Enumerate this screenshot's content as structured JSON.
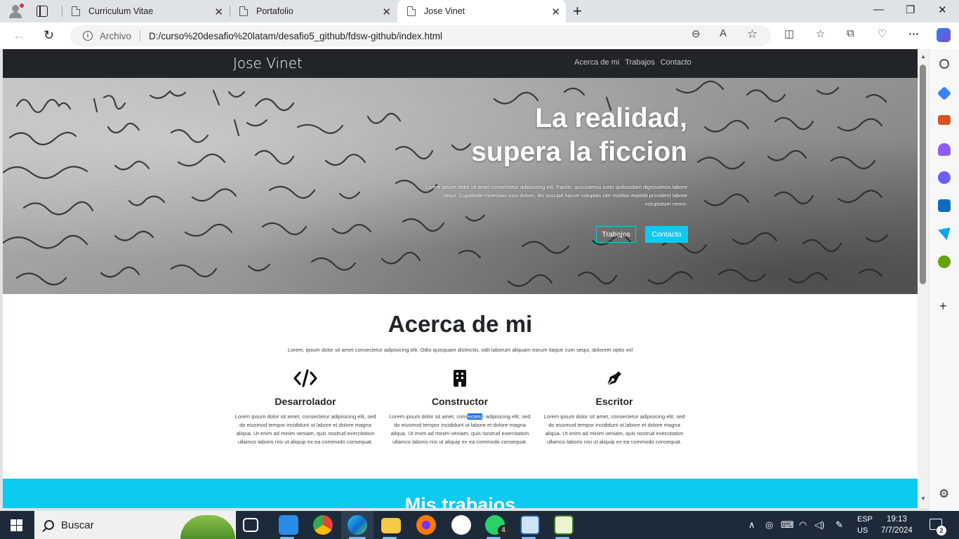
{
  "browser": {
    "tabs": [
      {
        "title": "Curriculum Vitae",
        "active": false
      },
      {
        "title": "Portafolio",
        "active": false
      },
      {
        "title": "Jose Vinet",
        "active": true
      }
    ],
    "address": {
      "protocol_label": "Archivo",
      "url": "D:/curso%20desafio%20latam/desafio5_github/fdsw-github/index.html"
    }
  },
  "site": {
    "brand": "Jose Vinet",
    "nav": [
      "Acerca de mi",
      "Trabajos",
      "Contacto"
    ],
    "hero": {
      "title_line1": "La realidad,",
      "title_line2": "supera la ficcion",
      "lead": "Lorem ipsum dolor sit amet consectetur adipisicing elit. Facilis, accusamus iusto quibusdam dignissimos labore sequi. Cupiditate molestias eius dolore, illo suscipit harum voluptas iste mollitia impedit provident labore voluptatum nemo.",
      "btn_outline": "Trabajos",
      "btn_solid": "Contacto"
    },
    "about": {
      "title": "Acerca de mi",
      "intro": "Lorem, ipsum dolor sit amet consectetur adipisicing elit. Odio quisquam distinctio, odit laborum aliquam earum itaque cum sequi, dolorem optio vol",
      "features": [
        {
          "icon": "code-icon",
          "title": "Desarrolador",
          "text": "Lorem ipsum dolor sit amet, consectetur adipisicing elit, sed do eiusmod tempor incididunt ut labore et dolore magna aliqua. Ut enim ad minim veniam, quis nostrud exercitation ullamco laboris nisi ut aliquip ex ea commodo consequat."
        },
        {
          "icon": "building-icon",
          "title": "Constructor",
          "text_pre": "Lorem ipsum dolor sit amet, cons",
          "text_hl": "ectetu",
          "text_post": "r adipisicing elit, sed do eiusmod tempor incididunt ut labore et dolore magna aliqua. Ut enim ad minim veniam, quis nostrud exercitation ullamco laboris nisi ut aliquip ex ea commodo consequat."
        },
        {
          "icon": "pen-nib-icon",
          "title": "Escritor",
          "text": "Lorem ipsum dolor sit amet, consectetur adipisicing elit, sed do eiusmod tempor incididunt ut labore et dolore magna aliqua. Ut enim ad minim veniam, quis nostrud exercitation ullamco laboris nisi ut aliquip ex ea commodo consequat."
        }
      ]
    },
    "works": {
      "title": "Mis trabajos"
    }
  },
  "taskbar": {
    "search_label": "Buscar",
    "whatsapp_badge": "4",
    "lang_line1": "ESP",
    "lang_line2": "US",
    "time": "19:13",
    "date": "7/7/2024",
    "notifications": "2"
  },
  "colors": {
    "accent": "#0dcaf0",
    "navbar": "#212529",
    "taskbar": "#1c2a3a"
  }
}
